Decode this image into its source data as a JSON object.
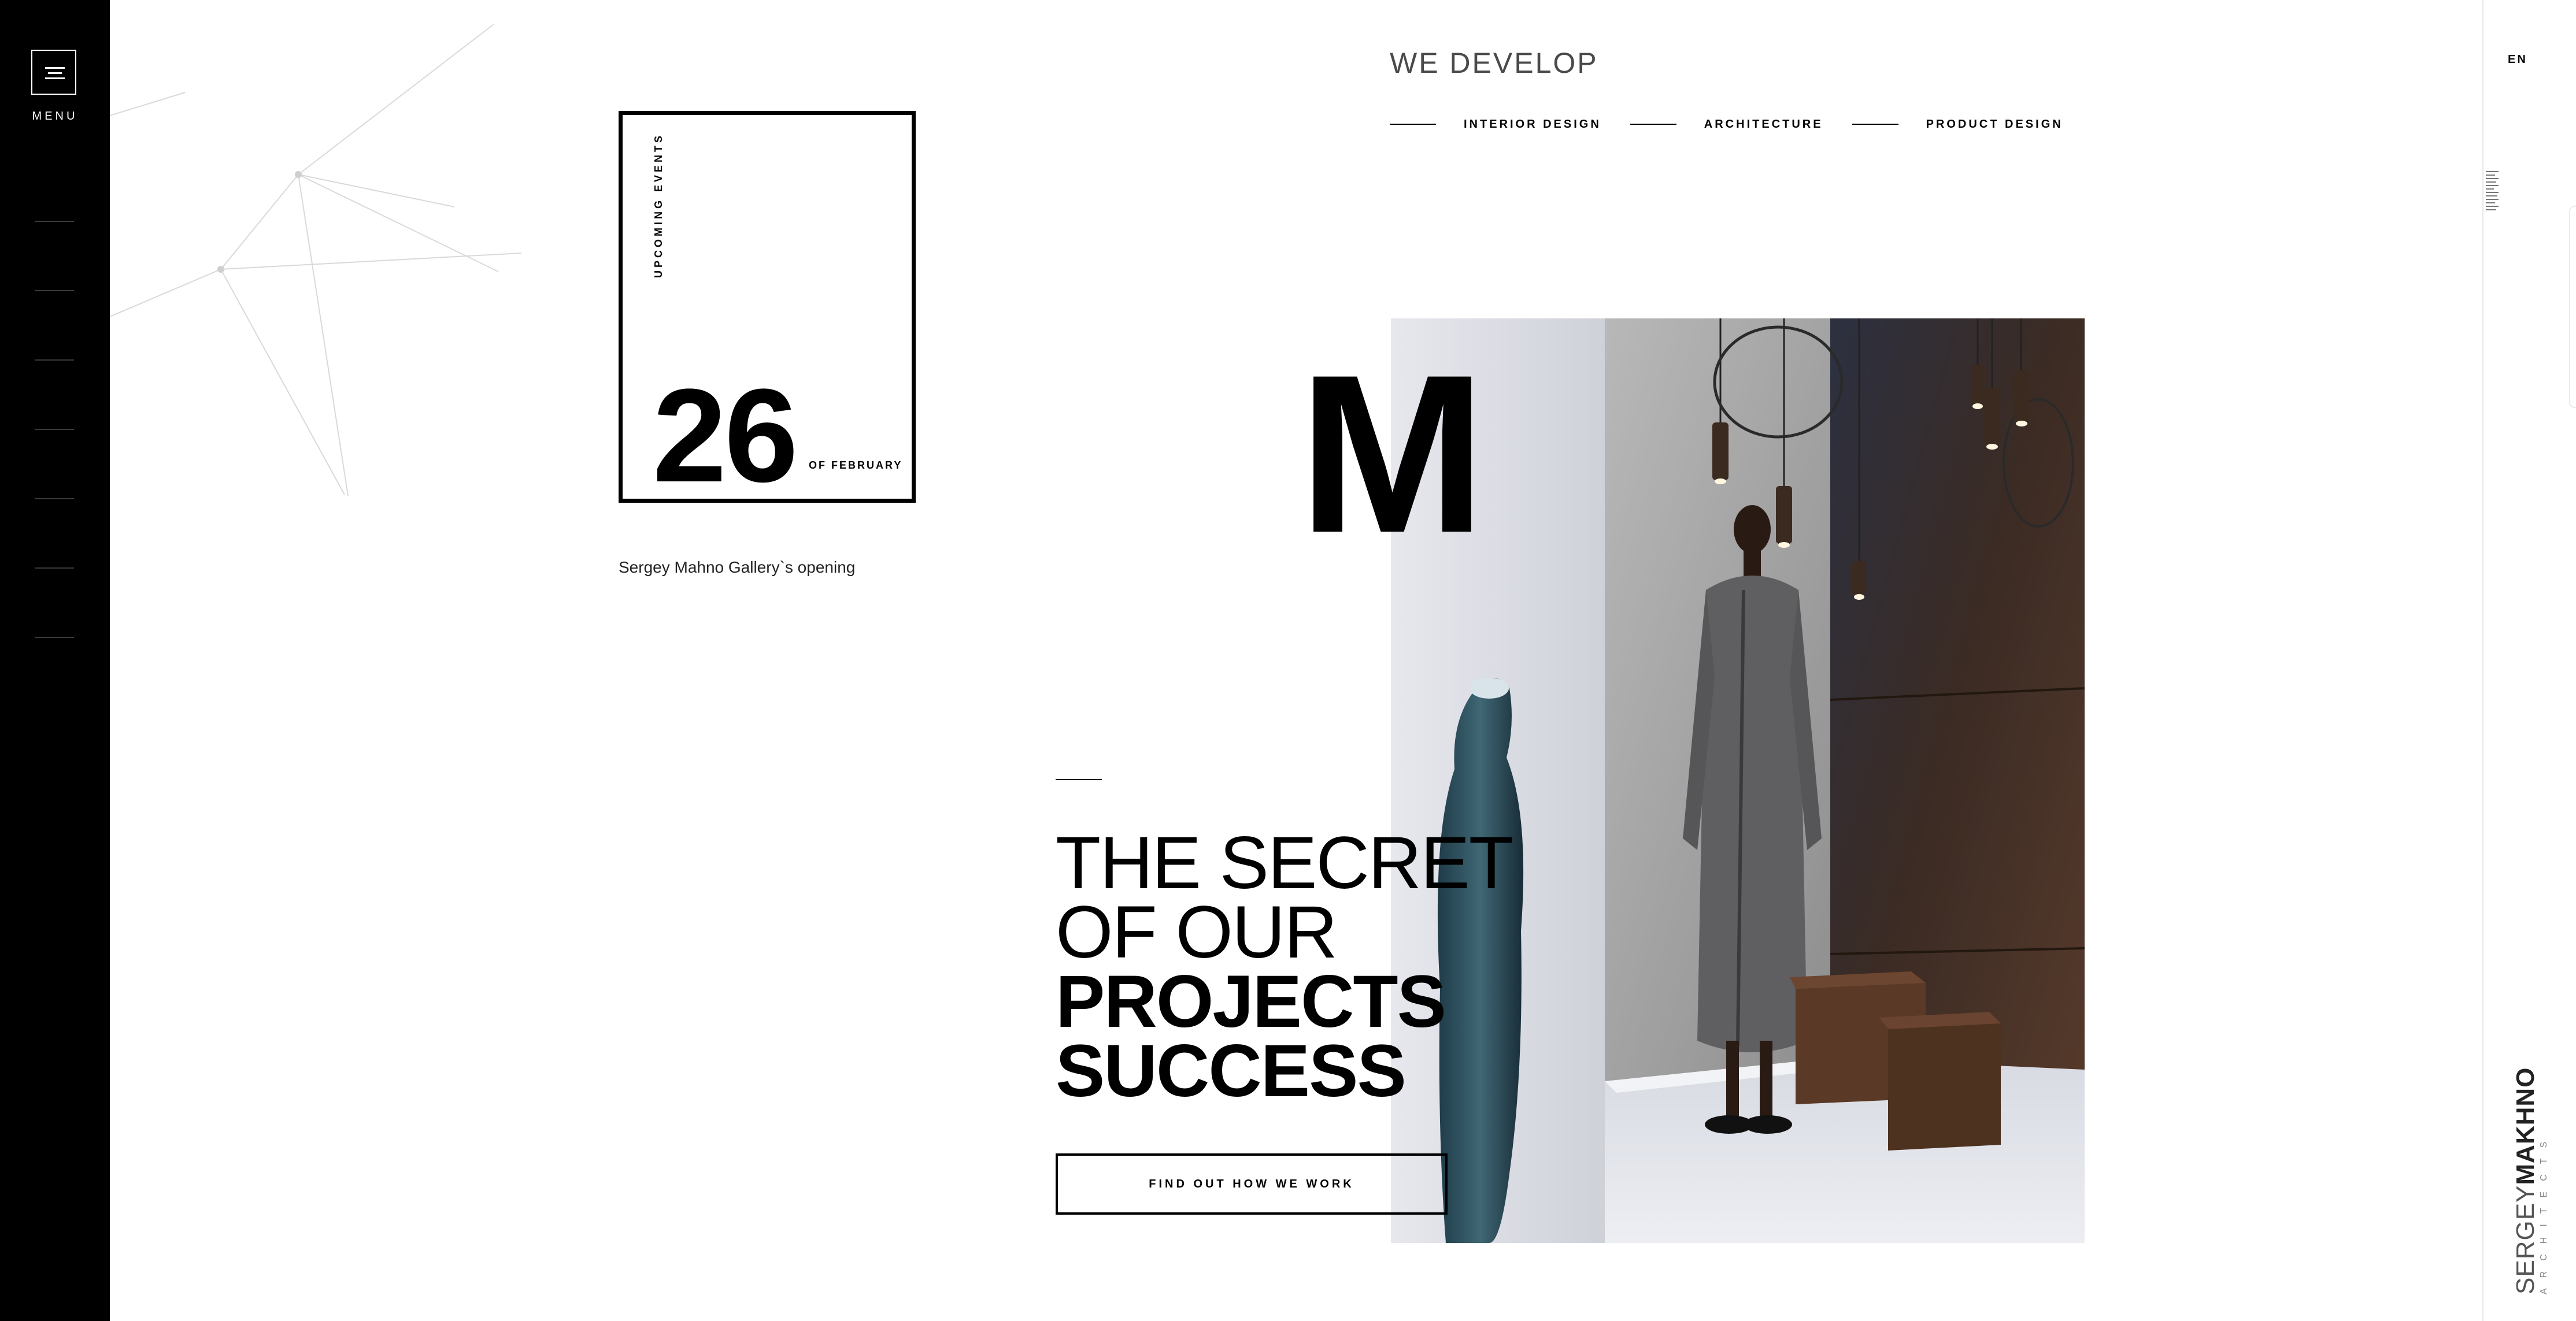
{
  "sidebar": {
    "menu_label": "MENU",
    "menu_icon": "hamburger-icon"
  },
  "header": {
    "title": "WE DEVELOP",
    "nav": [
      {
        "label": "INTERIOR DESIGN"
      },
      {
        "label": "ARCHITECTURE"
      },
      {
        "label": "PRODUCT DESIGN"
      }
    ]
  },
  "language": "EN",
  "event": {
    "section_label": "UPCOMING EVENTS",
    "day": "26",
    "month": "OF FEBRUARY",
    "caption": "Sergey Mahno Gallery`s opening"
  },
  "hero": {
    "letter": "M",
    "headline_light_1": "THE SECRET",
    "headline_light_2": "OF OUR",
    "headline_bold_1": "PROJECTS",
    "headline_bold_2": "SUCCESS",
    "cta_label": "FIND OUT HOW WE WORK"
  },
  "logo": {
    "first": "SERGEY",
    "last": "MAKHNO",
    "sub": "ARCHITECTS"
  },
  "colors": {
    "sidebar": "#000000",
    "background": "#ffffff",
    "text": "#000000"
  }
}
